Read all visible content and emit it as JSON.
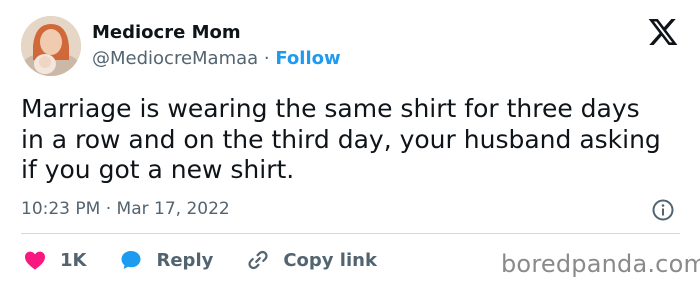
{
  "author": {
    "display_name": "Mediocre Mom",
    "handle": "@MediocreMamaa",
    "separator": " · ",
    "follow_label": "Follow",
    "avatar": "avatar-photo"
  },
  "platform": {
    "logo_icon": "x-logo-icon"
  },
  "post": {
    "text": "Marriage is wearing the same shirt for three days\nin a row and on the third day, your husband asking\nif you got a new shirt.",
    "timestamp": "10:23 PM · Mar 17, 2022",
    "info_icon": "info-icon"
  },
  "actions": {
    "like": {
      "icon": "heart-icon",
      "count": "1K",
      "color": "#f91880"
    },
    "reply": {
      "icon": "reply-bubble-icon",
      "label": "Reply",
      "color": "#1d9bf0"
    },
    "copy_link": {
      "icon": "link-icon",
      "label": "Copy link"
    }
  },
  "watermark": "boredpanda.com",
  "colors": {
    "accent": "#1d9bf0",
    "text": "#0f1419",
    "secondary": "#536471",
    "divider": "#cfd9de"
  }
}
